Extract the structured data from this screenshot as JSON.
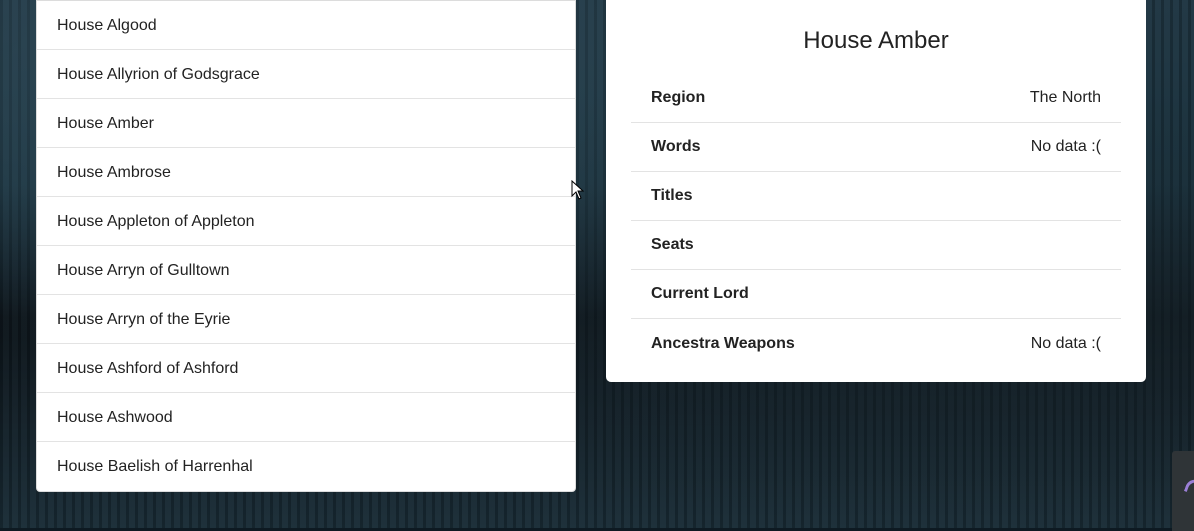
{
  "houses_list": {
    "items": [
      "House Algood",
      "House Allyrion of Godsgrace",
      "House Amber",
      "House Ambrose",
      "House Appleton of Appleton",
      "House Arryn of Gulltown",
      "House Arryn of the Eyrie",
      "House Ashford of Ashford",
      "House Ashwood",
      "House Baelish of Harrenhal"
    ]
  },
  "detail": {
    "title": "House Amber",
    "rows": [
      {
        "label": "Region",
        "value": "The North"
      },
      {
        "label": "Words",
        "value": "No data :("
      },
      {
        "label": "Titles",
        "value": ""
      },
      {
        "label": "Seats",
        "value": ""
      },
      {
        "label": "Current Lord",
        "value": ""
      },
      {
        "label": "Ancestra Weapons",
        "value": "No data :("
      }
    ]
  }
}
